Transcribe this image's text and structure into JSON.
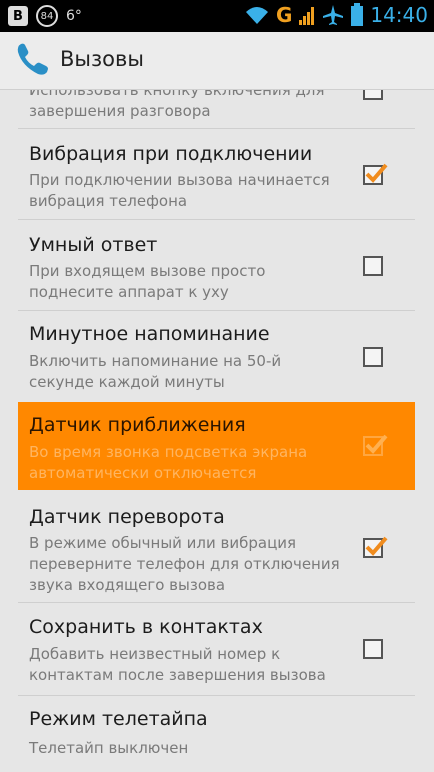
{
  "status_bar": {
    "badge_b": "B",
    "badge_84": "84",
    "temperature": "6°",
    "network": "G",
    "time": "14:40"
  },
  "action_bar": {
    "title": "Вызовы",
    "icon": "phone-icon"
  },
  "items": [
    {
      "title": "",
      "summary": "Использовать кнопку включения для завершения разговора",
      "checked": false
    },
    {
      "title": "Вибрация при подключении",
      "summary": "При подключении вызова начинается вибрация телефона",
      "checked": true
    },
    {
      "title": "Умный ответ",
      "summary": "При входящем вызове просто поднесите аппарат к уху",
      "checked": false
    },
    {
      "title": "Минутное напоминание",
      "summary": "Включить напоминание на 50-й секунде каждой минуты",
      "checked": false
    },
    {
      "title": "Датчик приближения",
      "summary": "Во время звонка подсветка экрана автоматически отключается",
      "checked": true,
      "pressed": true
    },
    {
      "title": "Датчик переворота",
      "summary": "В режиме обычный или вибрация переверните телефон для отключения звука входящего вызова",
      "checked": true
    },
    {
      "title": "Сохранить в контактах",
      "summary": "Добавить неизвестный номер к контактам после завершения вызова",
      "checked": false
    },
    {
      "title": "Режим телетайпа",
      "summary": "Телетайп выключен"
    }
  ],
  "colors": {
    "accent": "#ff8800",
    "check": "#f08c1e",
    "time": "#3ab0e8"
  }
}
